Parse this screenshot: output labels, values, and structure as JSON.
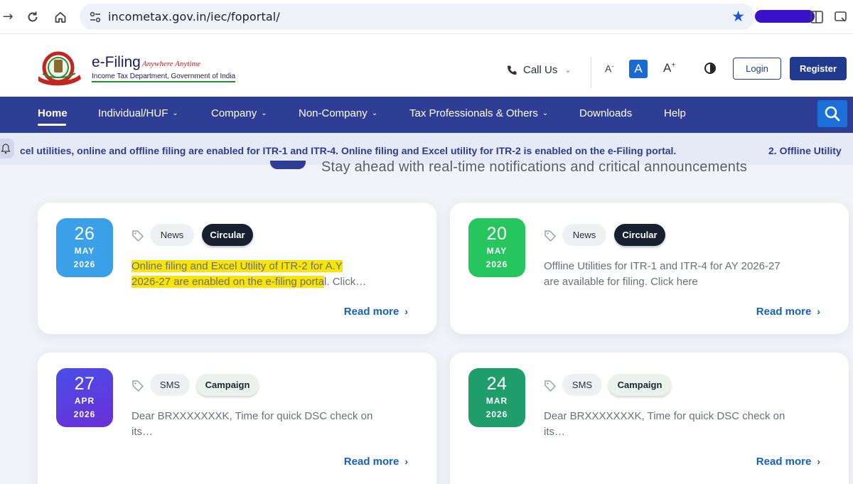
{
  "browser": {
    "url": "incometax.gov.in/iec/foportal/"
  },
  "header": {
    "logo_title": "e-Filing",
    "logo_tagline": "Anywhere Anytime",
    "logo_subtitle": "Income Tax Department, Government of India",
    "call_us": "Call Us",
    "font_small": "A",
    "font_normal": "A",
    "font_large": "A",
    "login": "Login",
    "register": "Register"
  },
  "nav": {
    "items": [
      {
        "label": "Home"
      },
      {
        "label": "Individual/HUF"
      },
      {
        "label": "Company"
      },
      {
        "label": "Non-Company"
      },
      {
        "label": "Tax Professionals & Others"
      },
      {
        "label": "Downloads"
      },
      {
        "label": "Help"
      }
    ]
  },
  "ticker": {
    "text": "cel utilities, online and offline filing are enabled for ITR-1 and ITR-4. Online filing and Excel utility for ITR-2 is enabled on the e-Filing portal.",
    "text2": "2. Offline Utility"
  },
  "section": {
    "subtitle": "Stay ahead with real-time notifications and critical announcements"
  },
  "cards": [
    {
      "day": "26",
      "month": "MAY",
      "year": "2026",
      "tags": [
        "News",
        "Circular"
      ],
      "desc_highlight_1": "Online filing and Excel Utility of ITR-2 for A.Y",
      "desc_highlight_2": "2026-27 are enabled on the e-filing porta",
      "desc_rest": "l. Click…",
      "read_more": "Read more"
    },
    {
      "day": "20",
      "month": "MAY",
      "year": "2026",
      "tags": [
        "News",
        "Circular"
      ],
      "desc": "Offline Utilities for ITR-1 and ITR-4 for AY 2026-27 are available for filing. Click here",
      "read_more": "Read more"
    },
    {
      "day": "27",
      "month": "APR",
      "year": "2026",
      "tags": [
        "SMS",
        "Campaign"
      ],
      "desc": "Dear BRXXXXXXXK, Time for quick DSC check on its…",
      "read_more": "Read more"
    },
    {
      "day": "24",
      "month": "MAR",
      "year": "2026",
      "tags": [
        "SMS",
        "Campaign"
      ],
      "desc": "Dear BRXXXXXXXK, Time for quick DSC check on its…",
      "read_more": "Read more"
    }
  ],
  "colors": {
    "nav_bg": "#2e3e94",
    "date_blue": "#3aa0e8",
    "date_green": "#27c55e",
    "date_purple": "#5b3ee0",
    "date_teal": "#1f9d6a",
    "link": "#1760b8"
  },
  "icons": {
    "back": "arrow-right-icon",
    "reload": "reload-icon",
    "home": "home-icon",
    "site_settings": "tune-icon",
    "bookmark": "star-icon",
    "phone": "phone-icon",
    "contrast": "contrast-icon",
    "search": "search-icon",
    "tag": "tag-icon",
    "bell": "bell-icon"
  }
}
